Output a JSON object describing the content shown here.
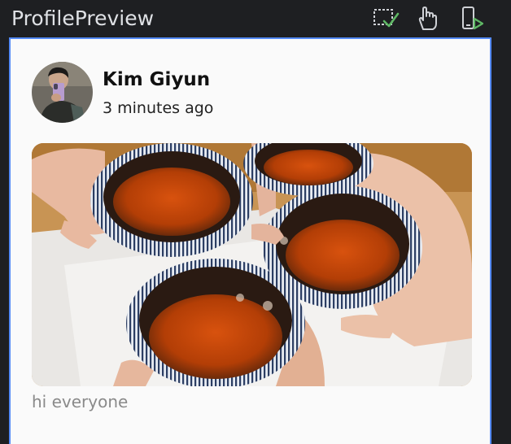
{
  "toolbar": {
    "title": "ProfilePreview",
    "buttons": [
      {
        "icon": "preview-check-icon",
        "label": ""
      },
      {
        "icon": "interactive-mode-icon",
        "label": ""
      },
      {
        "icon": "run-on-device-icon",
        "label": ""
      }
    ]
  },
  "post": {
    "author": "Kim Giyun",
    "time": "3 minutes ago",
    "caption": "hi everyone"
  },
  "colors": {
    "toolbar_bg": "#1e1f22",
    "frame_border": "#548af7",
    "card_bg": "#fafafa",
    "check_green": "#5fb865"
  }
}
